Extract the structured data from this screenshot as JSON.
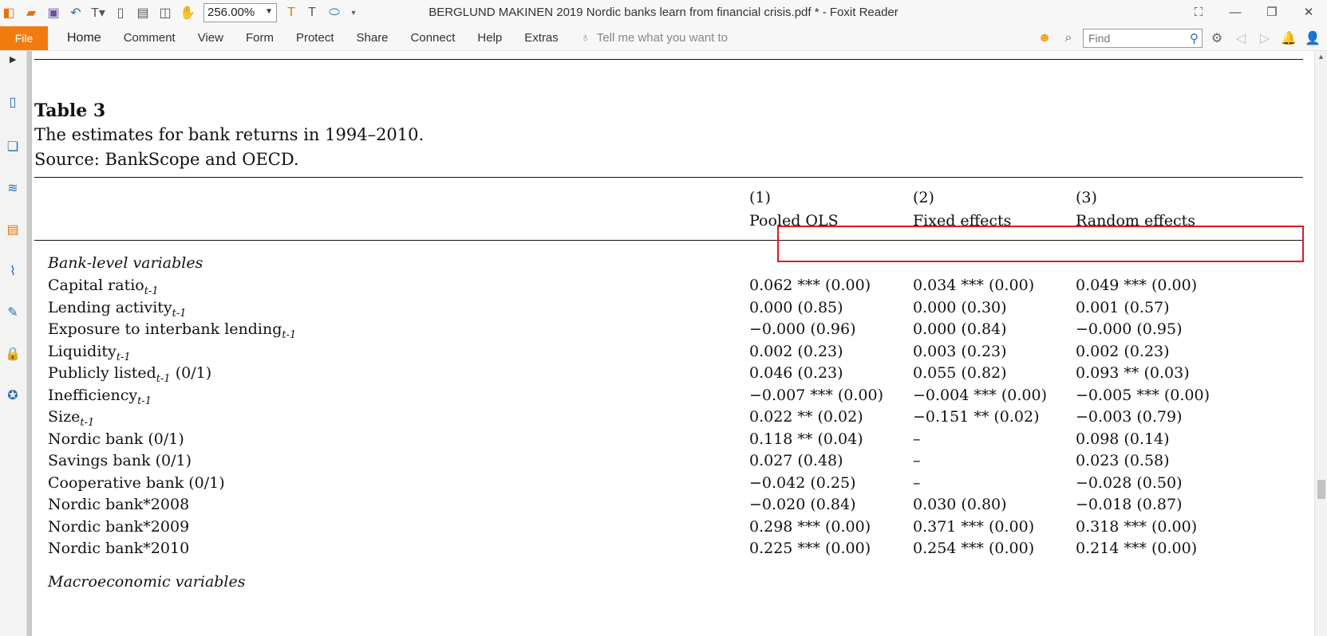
{
  "app": {
    "window_title": "BERGLUND MAKINEN 2019 Nordic banks learn from financial crisis.pdf * - Foxit Reader",
    "zoom_value": "256.00%"
  },
  "menu": {
    "file": "File",
    "items": [
      "Home",
      "Comment",
      "View",
      "Form",
      "Protect",
      "Share",
      "Connect",
      "Help",
      "Extras"
    ],
    "tell_me_placeholder": "Tell me what you want to",
    "find_placeholder": "Find"
  },
  "table": {
    "title": "Table 3",
    "caption": "The estimates for bank returns in 1994–2010.",
    "source": "Source: BankScope and OECD.",
    "columns": [
      {
        "num": "(1)",
        "name": "Pooled OLS"
      },
      {
        "num": "(2)",
        "name": "Fixed effects"
      },
      {
        "num": "(3)",
        "name": "Random effects"
      }
    ],
    "section_bank": "Bank-level variables",
    "section_macro": "Macroeconomic variables",
    "rows": [
      {
        "label": "Capital ratio",
        "sub": "t-1",
        "suffix": "",
        "v1": "0.062 *** (0.00)",
        "v2": "0.034 *** (0.00)",
        "v3": "0.049 *** (0.00)"
      },
      {
        "label": "Lending activity",
        "sub": "t-1",
        "suffix": "",
        "v1": "0.000 (0.85)",
        "v2": "0.000 (0.30)",
        "v3": "0.001 (0.57)"
      },
      {
        "label": "Exposure to interbank lending",
        "sub": "t-1",
        "suffix": "",
        "v1": "−0.000 (0.96)",
        "v2": "0.000 (0.84)",
        "v3": "−0.000 (0.95)"
      },
      {
        "label": "Liquidity",
        "sub": "t-1",
        "suffix": "",
        "v1": "0.002 (0.23)",
        "v2": "0.003 (0.23)",
        "v3": "0.002 (0.23)"
      },
      {
        "label": "Publicly listed",
        "sub": "t-1",
        "suffix": " (0/1)",
        "v1": "0.046 (0.23)",
        "v2": "0.055 (0.82)",
        "v3": "0.093 ** (0.03)"
      },
      {
        "label": "Inefficiency",
        "sub": "t-1",
        "suffix": "",
        "v1": "−0.007 *** (0.00)",
        "v2": "−0.004 *** (0.00)",
        "v3": "−0.005 *** (0.00)"
      },
      {
        "label": "Size",
        "sub": "t-1",
        "suffix": "",
        "v1": "0.022 ** (0.02)",
        "v2": "−0.151 ** (0.02)",
        "v3": "−0.003 (0.79)"
      },
      {
        "label": "Nordic bank (0/1)",
        "sub": "",
        "suffix": "",
        "v1": "0.118 ** (0.04)",
        "v2": "–",
        "v3": "0.098 (0.14)"
      },
      {
        "label": "Savings bank (0/1)",
        "sub": "",
        "suffix": "",
        "v1": "0.027 (0.48)",
        "v2": "–",
        "v3": "0.023 (0.58)"
      },
      {
        "label": "Cooperative bank (0/1)",
        "sub": "",
        "suffix": "",
        "v1": "−0.042 (0.25)",
        "v2": "–",
        "v3": "−0.028 (0.50)"
      },
      {
        "label": "Nordic bank*2008",
        "sub": "",
        "suffix": "",
        "v1": "−0.020 (0.84)",
        "v2": "0.030 (0.80)",
        "v3": "−0.018 (0.87)"
      },
      {
        "label": "Nordic bank*2009",
        "sub": "",
        "suffix": "",
        "v1": "0.298 *** (0.00)",
        "v2": "0.371 *** (0.00)",
        "v3": "0.318 *** (0.00)"
      },
      {
        "label": "Nordic bank*2010",
        "sub": "",
        "suffix": "",
        "v1": "0.225 *** (0.00)",
        "v2": "0.254 *** (0.00)",
        "v3": "0.214 *** (0.00)"
      }
    ]
  },
  "colors": {
    "file_tab": "#f07c0f",
    "highlight_box": "#e0191f"
  }
}
